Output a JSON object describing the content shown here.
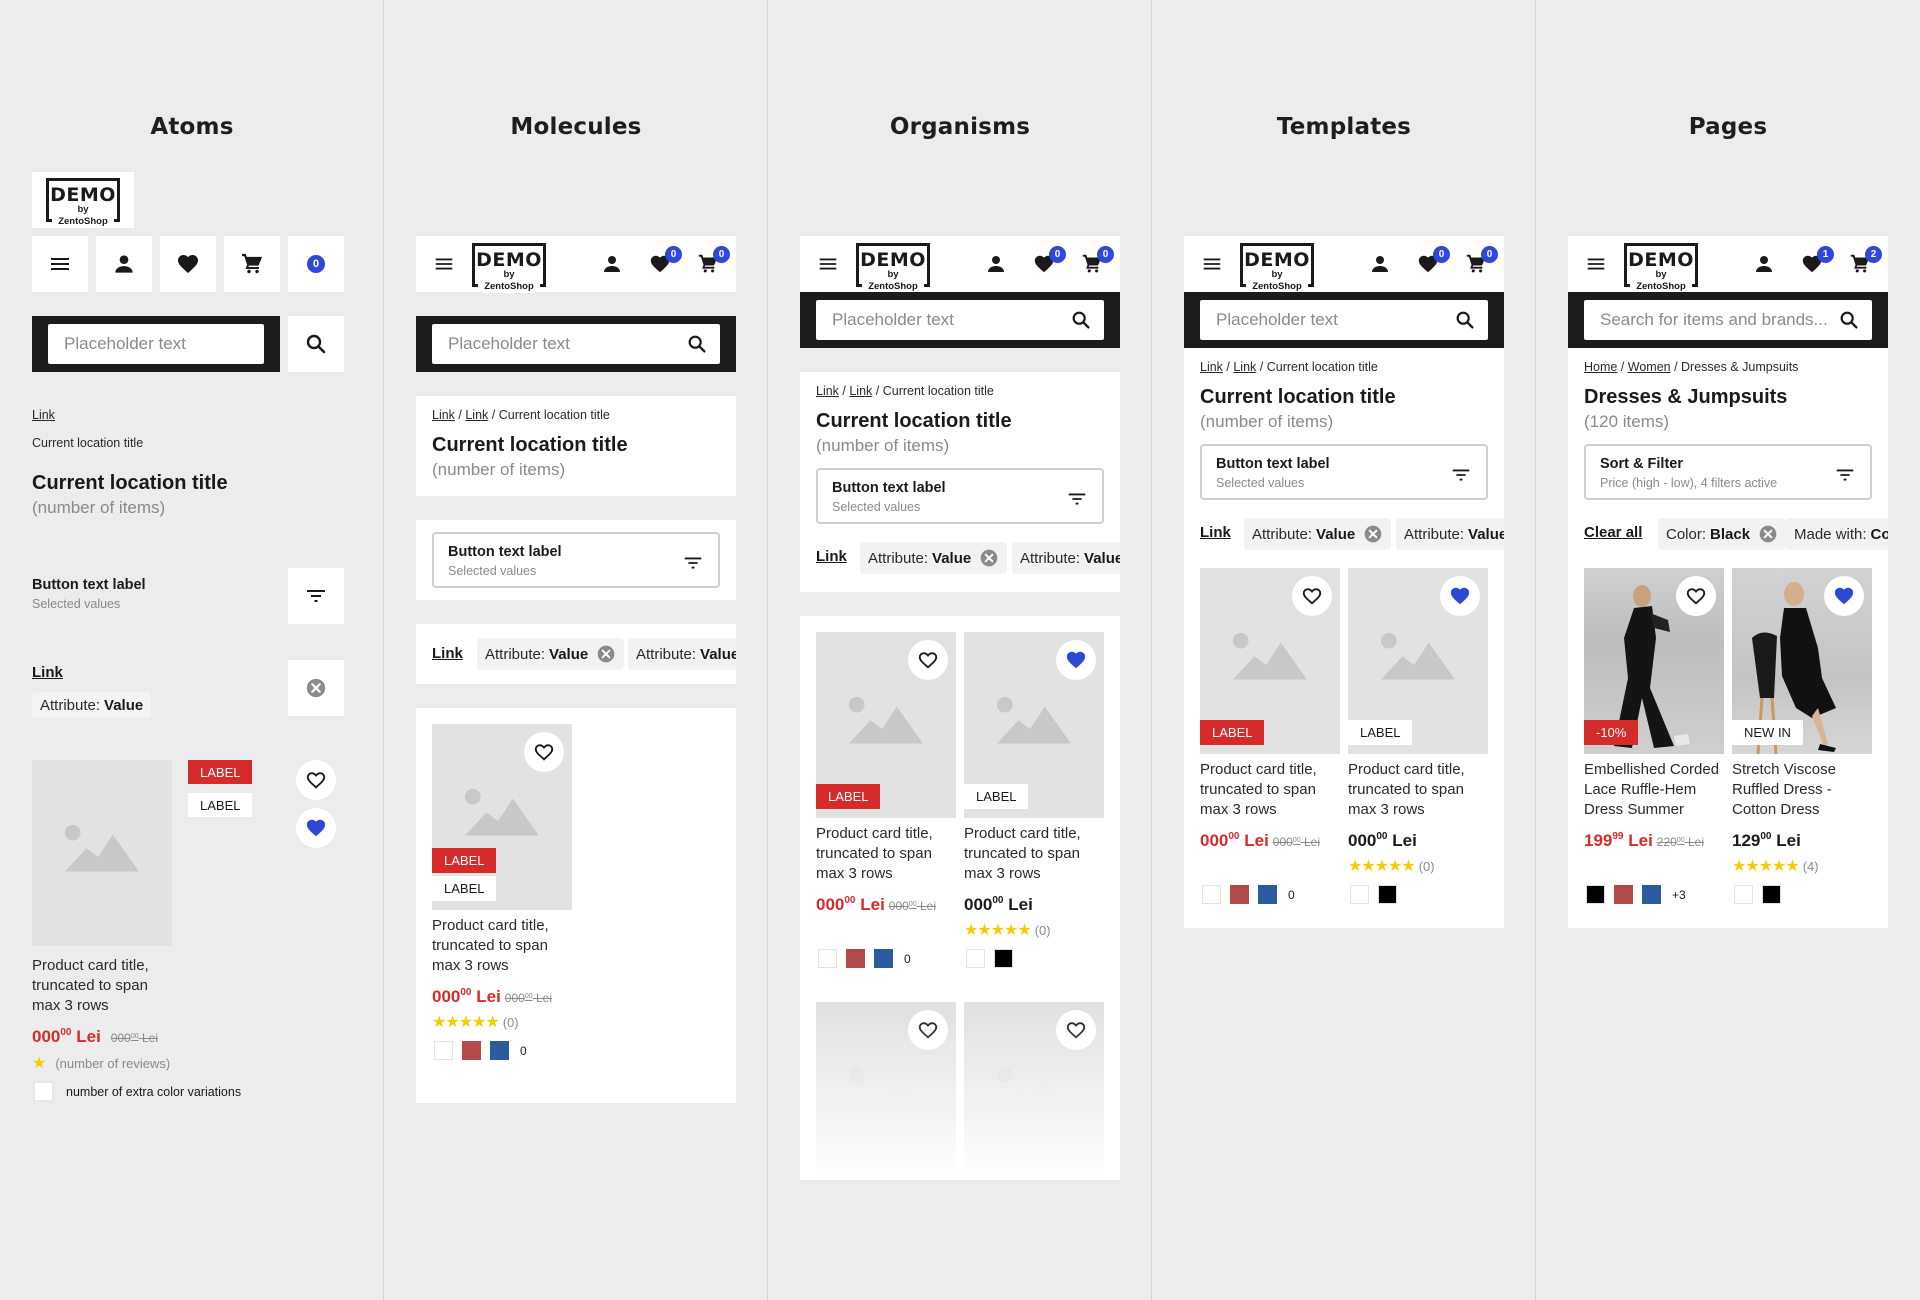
{
  "columns": [
    "Atoms",
    "Molecules",
    "Organisms",
    "Templates",
    "Pages"
  ],
  "brand": {
    "logo_main": "DEMO",
    "logo_sub": "by ZentoShop"
  },
  "colors": {
    "accent_blue": "#2f48d6",
    "sale_red": "#d62b2b",
    "star_yellow": "#f5cc00",
    "header_black": "#1c1c1c",
    "swatch_red": "#b54848",
    "swatch_blue": "#2d5a9c",
    "swatch_black": "#000000",
    "swatch_white": "#ffffff"
  },
  "atoms": {
    "badge_count": "0",
    "search_placeholder": "Placeholder text",
    "link": "Link",
    "current_location": "Current location title",
    "title": "Current location title",
    "subtitle": "(number of items)",
    "filter_label": "Button text label",
    "filter_values": "Selected values",
    "link_bold": "Link",
    "chip_attr": "Attribute:",
    "chip_value": "Value",
    "label_red": "LABEL",
    "label_white": "LABEL",
    "product_title": "Product card title, truncated to span max 3 rows",
    "price_main": "000",
    "price_cents": "00",
    "price_currency": "Lei",
    "old_price_main": "000",
    "old_price_cents": "00",
    "old_price_currency": "Lei",
    "reviews_text": "(number of reviews)",
    "extra_colors_text": "number of extra color variations"
  },
  "molecules": {
    "wishlist_count": "0",
    "cart_count": "0",
    "search_placeholder": "Placeholder text",
    "breadcrumb": [
      "Link",
      "Link",
      "Current location title"
    ],
    "title": "Current location title",
    "subtitle": "(number of items)",
    "filter_label": "Button text label",
    "filter_values": "Selected values",
    "clear_link": "Link",
    "chips": [
      {
        "attr": "Attribute:",
        "value": "Value"
      },
      {
        "attr": "Attribute:",
        "value": "Value"
      }
    ],
    "product": {
      "label_red": "LABEL",
      "label_white": "LABEL",
      "title": "Product card title, truncated to span max 3 rows",
      "price_main": "000",
      "price_cents": "00",
      "currency": "Lei",
      "old_main": "000",
      "old_cents": "00",
      "old_currency": "Lei",
      "rating_stars": 5,
      "reviews": "(0)",
      "extra_colors": "0"
    }
  },
  "organisms": {
    "wishlist_count": "0",
    "cart_count": "0",
    "search_placeholder": "Placeholder text",
    "breadcrumb": [
      "Link",
      "Link",
      "Current location title"
    ],
    "title": "Current location title",
    "subtitle": "(number of items)",
    "filter_label": "Button text label",
    "filter_values": "Selected values",
    "clear_link": "Link",
    "chips": [
      {
        "attr": "Attribute:",
        "value": "Value"
      },
      {
        "attr": "Attribute:",
        "value": "Value"
      }
    ],
    "products": [
      {
        "label": "LABEL",
        "title": "Product card title, truncated to span max 3 rows",
        "price_main": "000",
        "price_cents": "00",
        "currency": "Lei",
        "old_main": "000",
        "old_cents": "00",
        "old_currency": "Lei",
        "extra_colors": "0",
        "favorited": false
      },
      {
        "label": "LABEL",
        "title": "Product card title, truncated to span max 3 rows",
        "price_main": "000",
        "price_cents": "00",
        "currency": "Lei",
        "rating_stars": 5,
        "reviews": "(0)",
        "favorited": true
      }
    ]
  },
  "templates": {
    "wishlist_count": "0",
    "cart_count": "0",
    "search_placeholder": "Placeholder text",
    "breadcrumb": [
      "Link",
      "Link",
      "Current location title"
    ],
    "title": "Current location title",
    "subtitle": "(number of items)",
    "filter_label": "Button text label",
    "filter_values": "Selected values",
    "clear_link": "Link",
    "chips": [
      {
        "attr": "Attribute:",
        "value": "Value"
      },
      {
        "attr": "Attribute:",
        "value": "Value"
      }
    ],
    "products": [
      {
        "label": "LABEL",
        "title": "Product card title, truncated to span max 3 rows",
        "price_main": "000",
        "price_cents": "00",
        "currency": "Lei",
        "old_main": "000",
        "old_cents": "00",
        "old_currency": "Lei",
        "extra_colors": "0",
        "favorited": false
      },
      {
        "label": "LABEL",
        "title": "Product card title, truncated to span max 3 rows",
        "price_main": "000",
        "price_cents": "00",
        "currency": "Lei",
        "rating_stars": 5,
        "reviews": "(0)",
        "favorited": true
      }
    ]
  },
  "pages": {
    "wishlist_count": "1",
    "cart_count": "2",
    "search_placeholder": "Search for items and brands...",
    "breadcrumb": [
      "Home",
      "Women",
      "Dresses & Jumpsuits"
    ],
    "title": "Dresses & Jumpsuits",
    "subtitle": "(120 items)",
    "filter_label": "Sort & Filter",
    "filter_values": "Price (high - low), 4 filters active",
    "clear_link": "Clear all",
    "chips": [
      {
        "attr": "Color:",
        "value": "Black"
      },
      {
        "attr": "Made with:",
        "value": "Cotton"
      }
    ],
    "products": [
      {
        "label": "-10%",
        "title": "Embellished Corded Lace Ruffle-Hem Dress Summer",
        "price_main": "199",
        "price_cents": "99",
        "currency": "Lei",
        "old_main": "220",
        "old_cents": "00",
        "old_currency": "Lei",
        "extra_colors": "+3",
        "favorited": false
      },
      {
        "label": "NEW IN",
        "title": "Stretch Viscose Ruffled Dress - Cotton Dress",
        "price_main": "129",
        "price_cents": "00",
        "currency": "Lei",
        "rating_stars": 5,
        "reviews": "(4)",
        "favorited": true
      }
    ]
  }
}
